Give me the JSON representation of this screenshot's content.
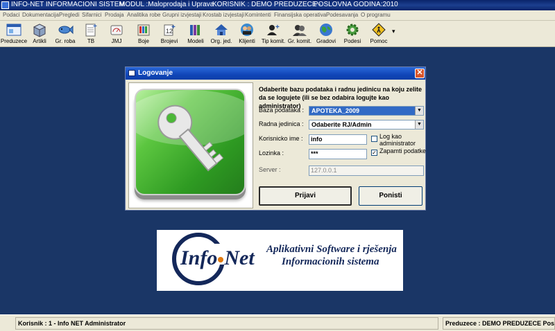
{
  "window": {
    "app_title": "INFO-NET INFORMACIONI SISTEM",
    "module": "MODUL :Maloprodaja i Uprava",
    "user": "KORISNIK : DEMO PREDUZECE -",
    "fiscal_year": "POSLOVNA GODINA:2010"
  },
  "menu": [
    "Podaci",
    "Dokumentacija",
    "Pregledi",
    "Sifarnici",
    "Prodaja",
    "Analitika robe",
    "Grupni izvjestaji",
    "Krostab izvjestaji",
    "Komintenti",
    "Finansijska operativa",
    "Podesavanja",
    "O programu"
  ],
  "toolbar": [
    {
      "label": "Preduzece",
      "icon": "window-icon"
    },
    {
      "label": "Artikli",
      "icon": "box-icon"
    },
    {
      "label": "Gr. roba",
      "icon": "fish-icon"
    },
    {
      "label": "TB",
      "icon": "document-plus-icon"
    },
    {
      "label": "JMJ",
      "icon": "scale-icon"
    },
    {
      "label": "Boje",
      "icon": "palette-icon"
    },
    {
      "label": "Brojevi",
      "icon": "number-icon"
    },
    {
      "label": "Modeli",
      "icon": "books-icon"
    },
    {
      "label": "Org. jed.",
      "icon": "house-icon"
    },
    {
      "label": "Klijenti",
      "icon": "people-icon"
    },
    {
      "label": "Tip komit.",
      "icon": "person-plus-icon"
    },
    {
      "label": "Gr. komit.",
      "icon": "group-icon"
    },
    {
      "label": "Gradovi",
      "icon": "globe-icon"
    },
    {
      "label": "Podesi",
      "icon": "gear-icon"
    },
    {
      "label": "Pomoc",
      "icon": "road-sign-icon"
    }
  ],
  "dialog": {
    "title": "Logovanje",
    "prompt": "Odaberite bazu podataka i radnu jedinicu  na koju zelite da se logujete (ili se bez odabira logujte kao administrator)",
    "database_label": "Baza podataka :",
    "database_value": "APOTEKA_2009",
    "unit_label": "Radna jedinica :",
    "unit_value": "Odaberite RJ/Admin",
    "username_label": "Korisnicko ime :",
    "username_value": "info",
    "password_label": "Lozinka :",
    "password_value": "***",
    "server_label": "Server :",
    "server_value": "127.0.0.1",
    "admin_check_label": "Log kao administrator",
    "admin_checked": false,
    "remember_check_label": "Zapamti podatke",
    "remember_checked": true,
    "login_button": "Prijavi",
    "cancel_button": "Ponisti"
  },
  "logo": {
    "brand": "Info·Net",
    "brand_left": "Info",
    "brand_right": "Net",
    "tagline_1": "Aplikativni Software i rješenja",
    "tagline_2": "Informacionih sistema"
  },
  "status": {
    "user": "Korisnik : 1 - Info NET  Administrator",
    "company": "Preduzece : DEMO PREDUZECE   Poslovna Godi"
  },
  "colors": {
    "workspace": "#1a3666",
    "accent_blue": "#316ac5",
    "key_green": "#2e9a22"
  }
}
